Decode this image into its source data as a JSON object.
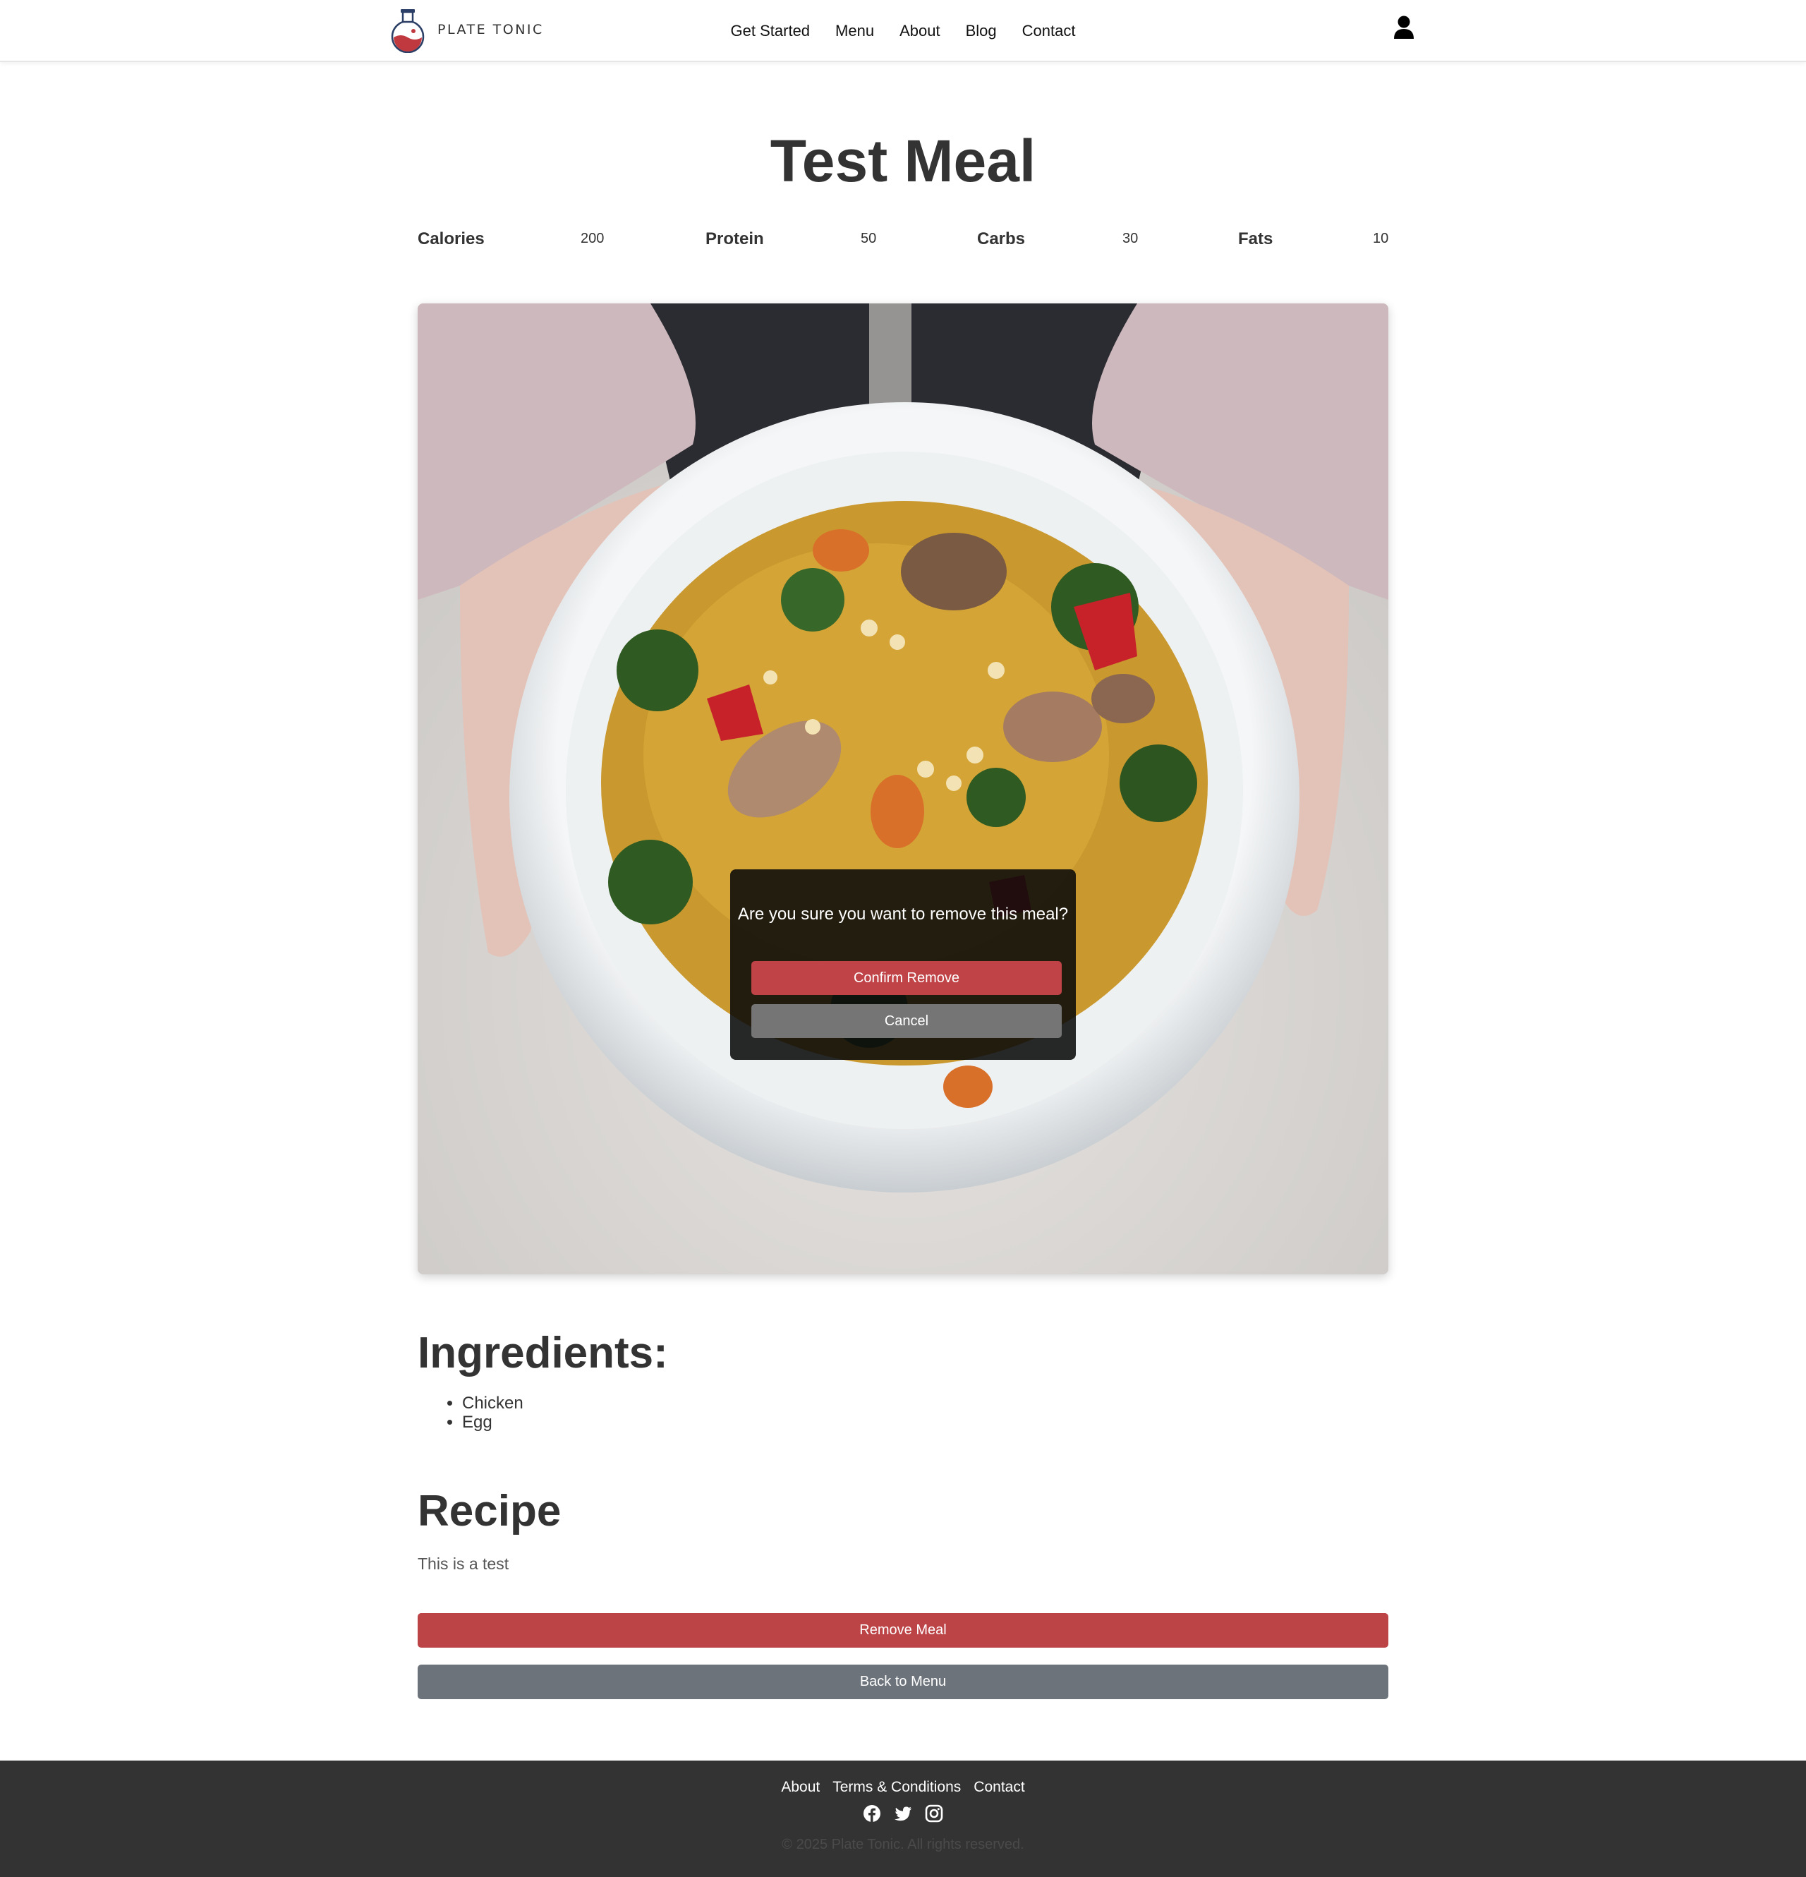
{
  "brand": {
    "name": "PLATE TONIC",
    "logo_icon": "flask-logo-icon"
  },
  "nav": {
    "links": [
      "Get Started",
      "Menu",
      "About",
      "Blog",
      "Contact"
    ],
    "user_icon": "user-icon"
  },
  "meal": {
    "title": "Test Meal",
    "macros": [
      {
        "label": "Calories",
        "value": "200"
      },
      {
        "label": "Protein",
        "value": "50"
      },
      {
        "label": "Carbs",
        "value": "30"
      },
      {
        "label": "Fats",
        "value": "10"
      }
    ],
    "ingredients_heading": "Ingredients:",
    "ingredients": [
      "Chicken",
      "Egg"
    ],
    "recipe_heading": "Recipe",
    "recipe_text": "This is a test"
  },
  "modal": {
    "message": "Are you sure you want to remove this meal?",
    "confirm_label": "Confirm Remove",
    "cancel_label": "Cancel"
  },
  "actions": {
    "remove_label": "Remove Meal",
    "back_label": "Back to Menu"
  },
  "footer": {
    "links": [
      "About",
      "Terms & Conditions",
      "Contact"
    ],
    "social_icons": [
      "facebook-icon",
      "twitter-icon",
      "instagram-icon"
    ],
    "copyright": "© 2025 Plate Tonic. All rights reserved."
  },
  "colors": {
    "remove": "#bc4346",
    "back": "#6c737b",
    "cancel": "#757575",
    "footer_bg": "#333333",
    "brand_red": "#c0393f",
    "brand_navy": "#2b3f66"
  }
}
